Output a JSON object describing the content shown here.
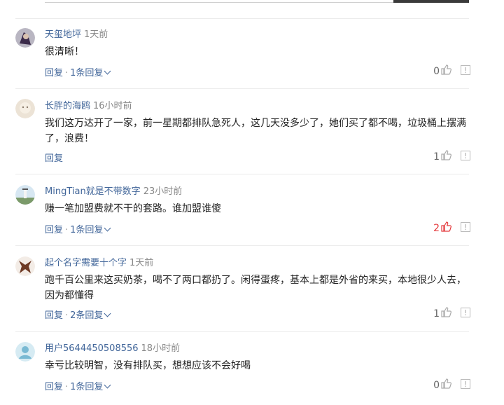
{
  "comments": [
    {
      "user": "天玺地坪",
      "time": "1天前",
      "text": "很清晰！",
      "reply_label": "回复",
      "replies_label": "1条回复",
      "likes": "0",
      "likes_highlight": false
    },
    {
      "user": "长胖的海鸥",
      "time": "16小时前",
      "text": "我们这万达开了一家，前一星期都排队急死人，这几天没多少了，她们买了都不喝，垃圾桶上摆满了，浪费！",
      "reply_label": "回复",
      "replies_label": "",
      "likes": "1",
      "likes_highlight": false
    },
    {
      "user": "MingTian就是不带数字",
      "time": "23小时前",
      "text": "赚一笔加盟费就不干的套路。谁加盟谁傻",
      "reply_label": "回复",
      "replies_label": "1条回复",
      "likes": "2",
      "likes_highlight": true
    },
    {
      "user": "起个名字需要十个字",
      "time": "1天前",
      "text": "跑千百公里来这买奶茶，喝不了两口都扔了。闲得蛋疼，基本上都是外省的来买，本地很少人去，因为都懂得",
      "reply_label": "回复",
      "replies_label": "2条回复",
      "likes": "1",
      "likes_highlight": false
    },
    {
      "user": "用户5644450508556",
      "time": "18小时前",
      "text": "幸亏比较明智，没有排队买，想想应该不会好喝",
      "reply_label": "回复",
      "replies_label": "1条回复",
      "likes": "0",
      "likes_highlight": false
    }
  ],
  "colors": {
    "link": "#406599",
    "like_active": "#e4393c",
    "time": "#888888"
  },
  "icons": {
    "like": "thumbs-up-icon",
    "report": "report-icon"
  }
}
